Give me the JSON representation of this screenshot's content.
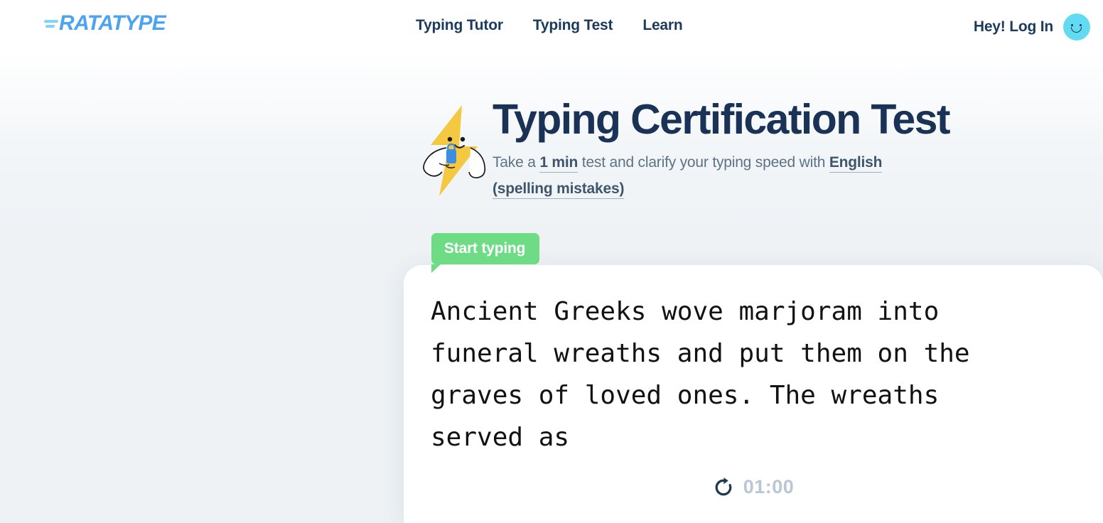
{
  "header": {
    "logo_text": "RATATYPE",
    "nav": [
      {
        "label": "Typing Tutor"
      },
      {
        "label": "Typing Test"
      },
      {
        "label": "Learn"
      }
    ],
    "account_label": "Hey! Log In",
    "avatar_icon": "smiley-avatar-icon"
  },
  "hero": {
    "mascot_icon": "lightning-bolt-mascot-icon",
    "title": "Typing Certification Test",
    "sub_prefix": "Take a ",
    "sub_duration": "1 min",
    "sub_middle": " test and clarify your typing speed with ",
    "sub_language": "English (spelling mistakes)"
  },
  "tip": {
    "label": "Start typing",
    "color": "#6ddc85"
  },
  "test": {
    "text": "Ancient Greeks wove marjoram into funeral wreaths and put them on the graves of loved ones. The wreaths served as",
    "timer": "01:00",
    "restart_icon": "restart-icon"
  },
  "colors": {
    "navy": "#1b3257",
    "logo_blue": "#4da3f0",
    "accent_green": "#6ddc85",
    "avatar_cyan": "#62dbf2",
    "page_bg": "#eef2f5"
  }
}
